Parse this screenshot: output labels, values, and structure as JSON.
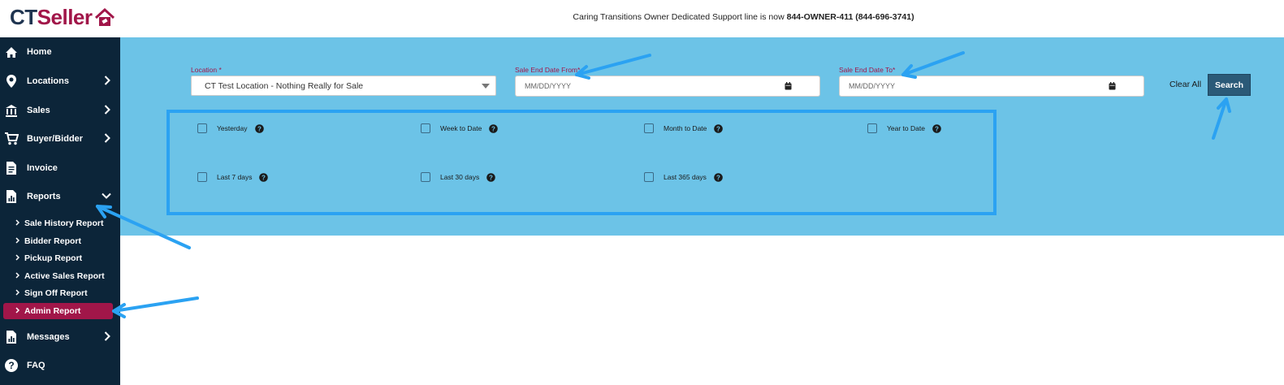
{
  "header": {
    "logo_ct": "CT",
    "logo_seller": "Seller",
    "support_text": "Caring Transitions Owner Dedicated Support line is now ",
    "support_number": "844-OWNER-411 (844-696-3741)"
  },
  "sidebar": {
    "items": [
      {
        "label": "Home",
        "icon": "home-icon"
      },
      {
        "label": "Locations",
        "icon": "map-pin-icon"
      },
      {
        "label": "Sales",
        "icon": "building-icon"
      },
      {
        "label": "Buyer/Bidder",
        "icon": "cart-icon"
      },
      {
        "label": "Invoice",
        "icon": "invoice-icon"
      },
      {
        "label": "Reports",
        "icon": "report-icon"
      },
      {
        "label": "Messages",
        "icon": "message-icon"
      },
      {
        "label": "FAQ",
        "icon": "help-icon"
      }
    ],
    "reports_sub": [
      "Sale History Report",
      "Bidder Report",
      "Pickup Report",
      "Active Sales Report",
      "Sign Off Report",
      "Admin Report"
    ],
    "active_sub": "Admin Report"
  },
  "filters": {
    "location_label": "Location *",
    "location_value": "CT Test Location - Nothing Really for Sale",
    "from_label": "Sale End Date From*",
    "from_placeholder": "MM/DD/YYYY",
    "to_label": "Sale End Date To*",
    "to_placeholder": "MM/DD/YYYY",
    "clear_label": "Clear All",
    "search_label": "Search"
  },
  "quick_ranges": [
    "Yesterday",
    "Week to Date",
    "Month to Date",
    "Year to Date",
    "Last 7 days",
    "Last 30 days",
    "Last 365 days"
  ],
  "colors": {
    "sidebar_bg": "#0c2539",
    "panel_bg": "#6cc3e7",
    "accent": "#a11649",
    "search_btn": "#2b5a78",
    "annotation": "#2ba2f2"
  }
}
